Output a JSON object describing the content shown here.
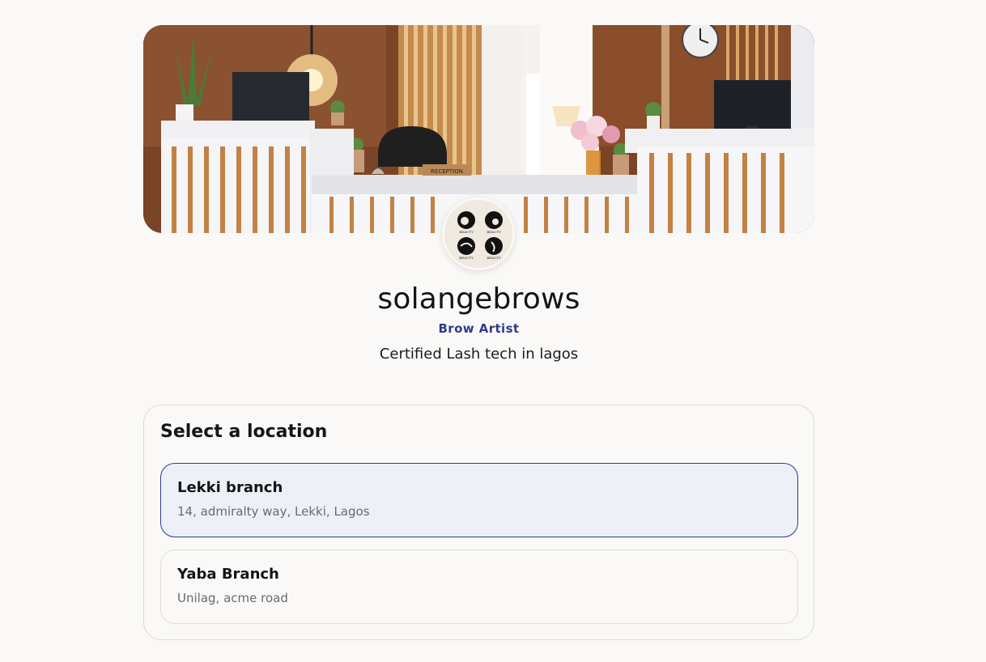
{
  "profile": {
    "username": "solangebrows",
    "role": "Brow Artist",
    "bio": "Certified Lash tech in lagos"
  },
  "cover": {
    "desk_sign": "RECEPTION"
  },
  "avatar": {
    "logo_caption": "BEAUTY"
  },
  "locations": {
    "title": "Select a location",
    "items": [
      {
        "name": "Lekki branch",
        "address": "14, admiralty way, Lekki, Lagos",
        "selected": true
      },
      {
        "name": "Yaba Branch",
        "address": "Unilag, acme road",
        "selected": false
      }
    ]
  },
  "colors": {
    "accent": "#2e3b8f",
    "selected_bg": "#eef0f8",
    "page_bg": "#faf9f7"
  }
}
